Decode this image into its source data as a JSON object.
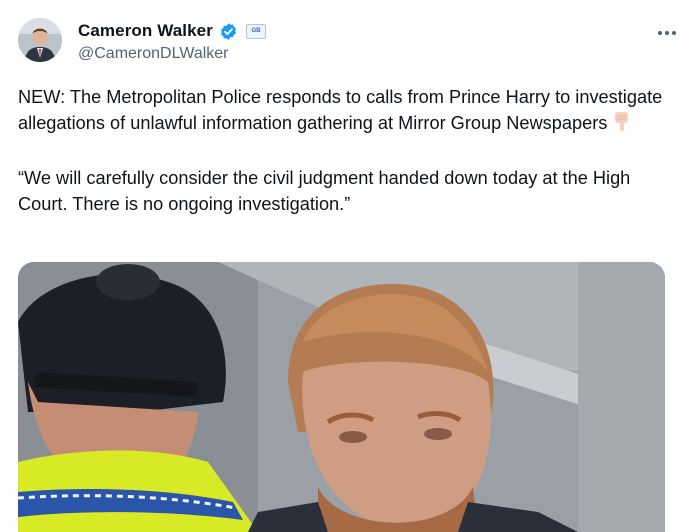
{
  "author": {
    "display_name": "Cameron Walker",
    "handle": "@CameronDLWalker",
    "verified_icon": "verified-badge-icon",
    "affiliate_badge_text": "GB",
    "affiliate_badge_icon": "affiliate-badge-icon"
  },
  "menu": {
    "icon": "more-icon"
  },
  "tweet": {
    "paragraph_1": "NEW: The Metropolitan Police responds to calls from Prince Harry to investigate allegations of unlawful information gathering at Mirror Group Newspapers",
    "emoji": "pointing-down-emoji",
    "paragraph_2": "“We will carefully consider the civil judgment handed down today at the High Court. There is no ongoing investigation.”"
  },
  "media": {
    "type": "photo"
  },
  "colors": {
    "verified": "#1d9bf0",
    "text": "#0f1419",
    "secondary": "#536471"
  }
}
